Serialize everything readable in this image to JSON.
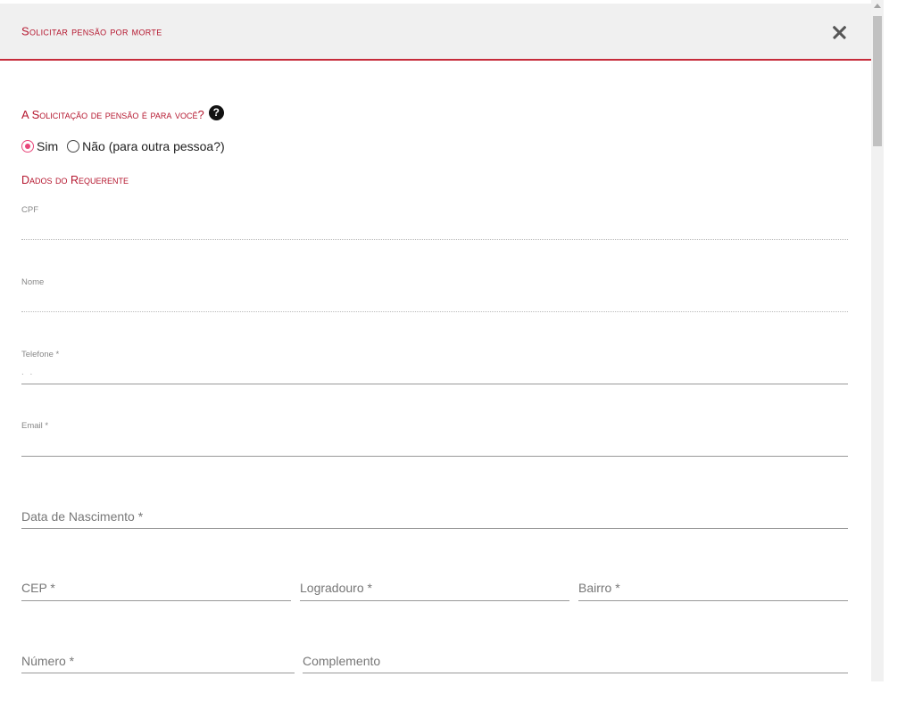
{
  "dialog": {
    "title": "Solicitar pensão por morte",
    "close_icon": "close-icon"
  },
  "question": {
    "text": "A Solicitação de pensão é para você?",
    "help_icon": "question-circle-icon",
    "help_glyph": "?"
  },
  "radios": [
    {
      "label": "Sim",
      "checked": true
    },
    {
      "label": "Não (para outra pessoa?)",
      "checked": false
    }
  ],
  "section": {
    "title": "Dados do Requerente"
  },
  "fields": {
    "cpf": {
      "label": "CPF",
      "value": ""
    },
    "nome": {
      "label": "Nome",
      "value": ""
    },
    "telefone": {
      "label": "Telefone *",
      "value": ". ."
    },
    "email": {
      "label": "Email *",
      "value": ""
    },
    "data_nascimento": {
      "label": "Data de Nascimento *",
      "value": ""
    },
    "cep": {
      "label": "CEP *",
      "value": ""
    },
    "logradouro": {
      "label": "Logradouro *",
      "value": ""
    },
    "bairro": {
      "label": "Bairro *",
      "value": ""
    },
    "numero": {
      "label": "Número *",
      "value": ""
    },
    "complemento": {
      "label": "Complemento",
      "value": ""
    }
  },
  "colors": {
    "accent": "#b5172f",
    "header_border": "#c62b3a",
    "radio_checked": "#e8457a",
    "header_bg": "#f0f0f0"
  }
}
